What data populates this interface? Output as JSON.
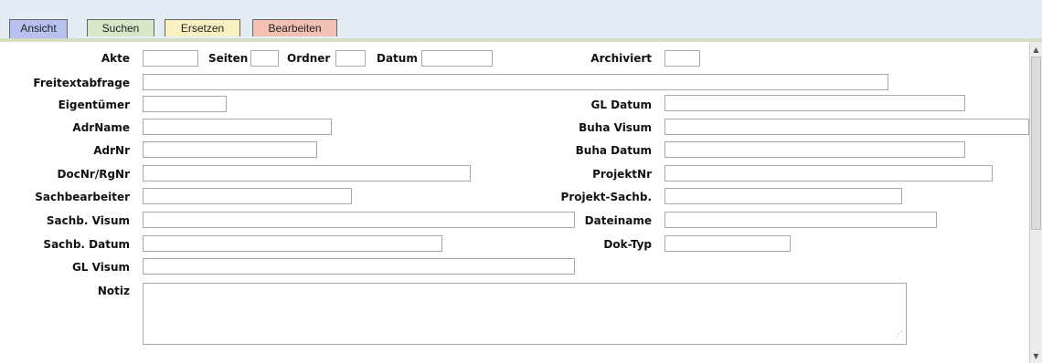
{
  "tabs": [
    {
      "label": "Ansicht"
    },
    {
      "label": "Suchen"
    },
    {
      "label": "Ersetzen"
    },
    {
      "label": "Bearbeiten"
    }
  ],
  "form": {
    "akte": "Akte",
    "seiten": "Seiten",
    "ordner": "Ordner",
    "datum": "Datum",
    "archiviert": "Archiviert",
    "freitextabfrage": "Freitextabfrage",
    "eigentuemer": "Eigentümer",
    "gl_datum": "GL Datum",
    "adrname": "AdrName",
    "buha_visum": "Buha Visum",
    "adrnr": "AdrNr",
    "buha_datum": "Buha Datum",
    "docnr": "DocNr/RgNr",
    "projektnr": "ProjektNr",
    "sachbearbeiter": "Sachbearbeiter",
    "projekt_sachb": "Projekt-Sachb.",
    "sachb_visum": "Sachb. Visum",
    "dateiname": "Dateiname",
    "sachb_datum": "Sachb. Datum",
    "dok_typ": "Dok-Typ",
    "gl_visum": "GL Visum",
    "notiz": "Notiz"
  },
  "colors": {
    "tab_ansicht": "#b7c0ee",
    "tab_suchen": "#d7e6c6",
    "tab_ersetzen": "#f8f0c0",
    "tab_bearbeiten": "#f4c0b4"
  }
}
